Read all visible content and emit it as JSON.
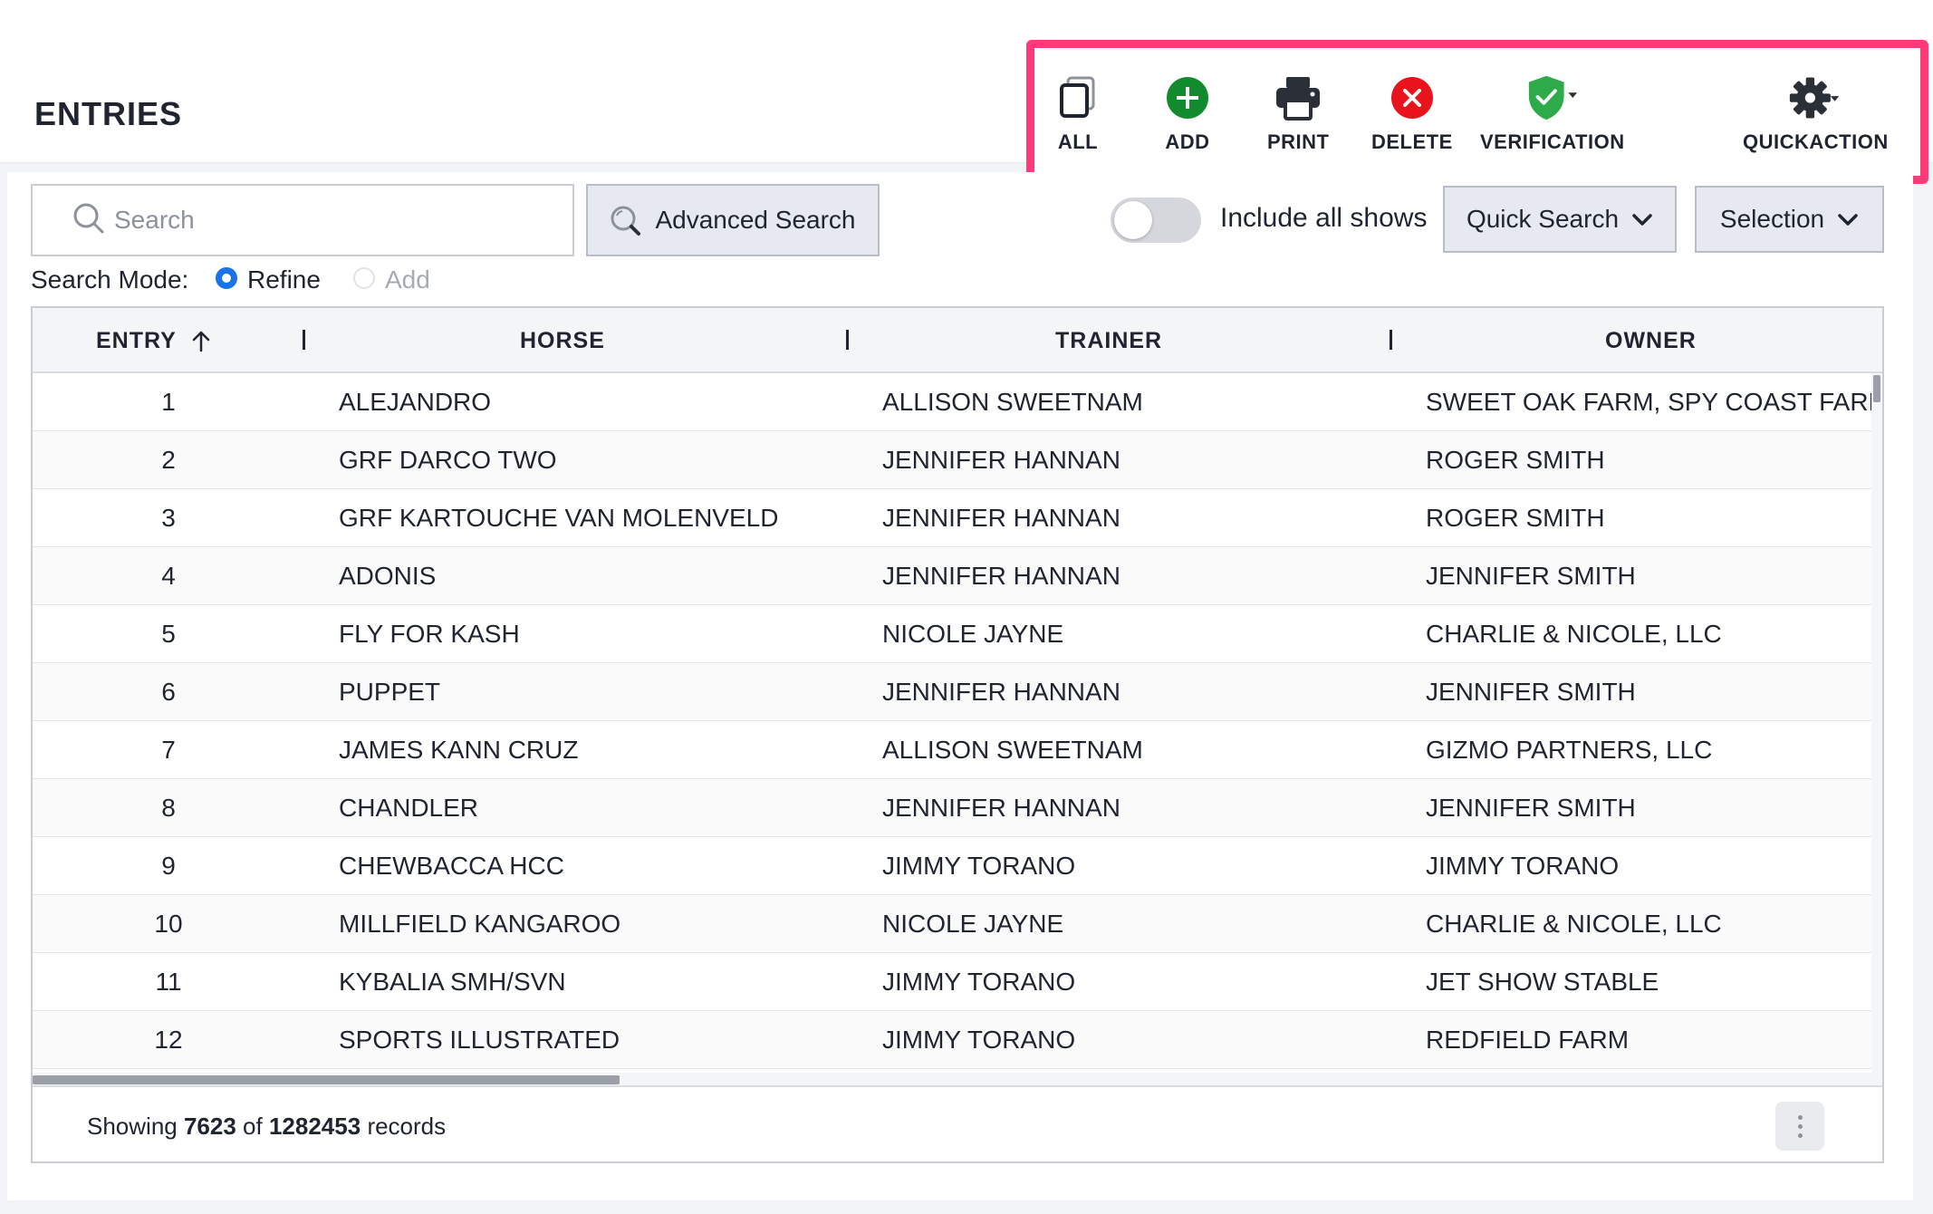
{
  "page": {
    "title": "ENTRIES"
  },
  "toolbar": {
    "all": "ALL",
    "add": "ADD",
    "print": "PRINT",
    "delete": "DELETE",
    "verification": "VERIFICATION",
    "quickaction": "QUICKACTION"
  },
  "search": {
    "placeholder": "Search",
    "advanced_label": "Advanced Search",
    "include_all_shows_label": "Include all shows",
    "include_all_shows_on": false,
    "quick_search_label": "Quick Search",
    "selection_label": "Selection",
    "mode_label": "Search Mode:",
    "mode_options": [
      "Refine",
      "Add"
    ],
    "mode_selected": "Refine"
  },
  "table": {
    "columns": [
      "ENTRY",
      "HORSE",
      "TRAINER",
      "OWNER"
    ],
    "sort_column": "ENTRY",
    "sort_direction": "ascending",
    "rows": [
      {
        "entry": "1",
        "horse": "ALEJANDRO",
        "trainer": "ALLISON SWEETNAM",
        "owner": "SWEET OAK FARM, SPY COAST FARM"
      },
      {
        "entry": "2",
        "horse": "GRF DARCO TWO",
        "trainer": "JENNIFER HANNAN",
        "owner": "ROGER SMITH"
      },
      {
        "entry": "3",
        "horse": "GRF KARTOUCHE VAN MOLENVELD",
        "trainer": "JENNIFER HANNAN",
        "owner": "ROGER SMITH"
      },
      {
        "entry": "4",
        "horse": "ADONIS",
        "trainer": "JENNIFER HANNAN",
        "owner": "JENNIFER SMITH"
      },
      {
        "entry": "5",
        "horse": "FLY FOR KASH",
        "trainer": "NICOLE JAYNE",
        "owner": "CHARLIE & NICOLE, LLC"
      },
      {
        "entry": "6",
        "horse": "PUPPET",
        "trainer": "JENNIFER HANNAN",
        "owner": "JENNIFER SMITH"
      },
      {
        "entry": "7",
        "horse": "JAMES KANN CRUZ",
        "trainer": "ALLISON SWEETNAM",
        "owner": "GIZMO PARTNERS, LLC"
      },
      {
        "entry": "8",
        "horse": "CHANDLER",
        "trainer": "JENNIFER HANNAN",
        "owner": "JENNIFER SMITH"
      },
      {
        "entry": "9",
        "horse": "CHEWBACCA HCC",
        "trainer": "JIMMY TORANO",
        "owner": "JIMMY TORANO"
      },
      {
        "entry": "10",
        "horse": "MILLFIELD KANGAROO",
        "trainer": "NICOLE JAYNE",
        "owner": "CHARLIE & NICOLE, LLC"
      },
      {
        "entry": "11",
        "horse": "KYBALIA SMH/SVN",
        "trainer": "JIMMY TORANO",
        "owner": "JET SHOW STABLE"
      },
      {
        "entry": "12",
        "horse": "SPORTS ILLUSTRATED",
        "trainer": "JIMMY TORANO",
        "owner": "REDFIELD FARM"
      }
    ]
  },
  "footer": {
    "prefix": "Showing",
    "shown": "7623",
    "middle": "of",
    "total": "1282453",
    "suffix": "records"
  },
  "colors": {
    "highlight": "#ff3a78",
    "add": "#128a2e",
    "delete": "#e8131b",
    "verification": "#2faa4a",
    "radio_selected": "#1b73e8"
  },
  "icons": [
    "copy-icon",
    "plus-circle-icon",
    "printer-icon",
    "close-circle-icon",
    "shield-check-icon",
    "gear-icon",
    "search-icon",
    "magnifier-icon",
    "chevron-down-icon",
    "sort-arrow-up-icon",
    "kebab-menu-icon"
  ]
}
